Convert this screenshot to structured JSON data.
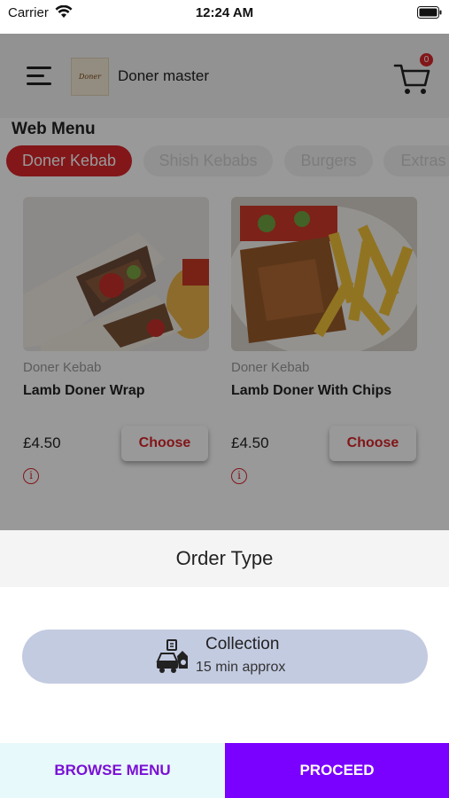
{
  "status_bar": {
    "carrier": "Carrier",
    "time": "12:24 AM"
  },
  "header": {
    "logo_text": "Doner",
    "store_name": "Doner master",
    "cart_count": "0"
  },
  "menu": {
    "title": "Web Menu",
    "tabs": [
      {
        "label": "Doner Kebab",
        "active": true
      },
      {
        "label": "Shish Kebabs",
        "active": false
      },
      {
        "label": "Burgers",
        "active": false
      },
      {
        "label": "Extras",
        "active": false
      }
    ],
    "products": [
      {
        "category": "Doner Kebab",
        "name": "Lamb Doner Wrap",
        "price": "£4.50",
        "button": "Choose",
        "info": "i"
      },
      {
        "category": "Doner Kebab",
        "name": "Lamb Doner With Chips",
        "price": "£4.50",
        "button": "Choose",
        "info": "i"
      }
    ]
  },
  "order_sheet": {
    "title": "Order Type",
    "option": {
      "label": "Collection",
      "subtext": "15 min approx"
    }
  },
  "bottom_bar": {
    "browse_label": "BROWSE MENU",
    "proceed_label": "PROCEED"
  },
  "colors": {
    "accent_red": "#d9252b",
    "proceed_purple": "#7a00ff",
    "browse_text": "#7a10d6",
    "collection_bg": "#c3cbe1"
  }
}
